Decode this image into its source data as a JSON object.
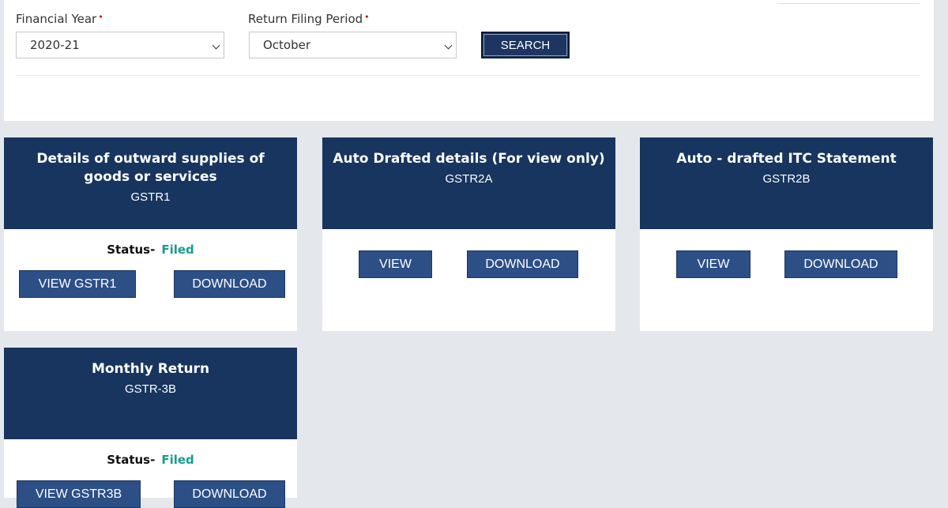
{
  "filters": {
    "financial_year_label": "Financial Year",
    "financial_year_value": "2020-21",
    "period_label": "Return Filing Period",
    "period_value": "October",
    "required_mark": "•",
    "search_label": "SEARCH"
  },
  "cards": [
    {
      "title": "Details of outward supplies of goods or services",
      "code": "GSTR1",
      "status_label": "Status-",
      "status_value": "Filed",
      "view_label": "VIEW GSTR1",
      "download_label": "DOWNLOAD"
    },
    {
      "title": "Auto Drafted details (For view only)",
      "code": "GSTR2A",
      "view_label": "VIEW",
      "download_label": "DOWNLOAD"
    },
    {
      "title": "Auto - drafted ITC Statement",
      "code": "GSTR2B",
      "view_label": "VIEW",
      "download_label": "DOWNLOAD"
    },
    {
      "title": "Monthly Return",
      "code": "GSTR-3B",
      "status_label": "Status-",
      "status_value": "Filed",
      "view_label": "VIEW GSTR3B",
      "download_label": "DOWNLOAD"
    }
  ],
  "colors": {
    "card_header": "#17355e",
    "button": "#2c4f86",
    "status_filed": "#1a9b8f",
    "required": "#d0021b"
  }
}
